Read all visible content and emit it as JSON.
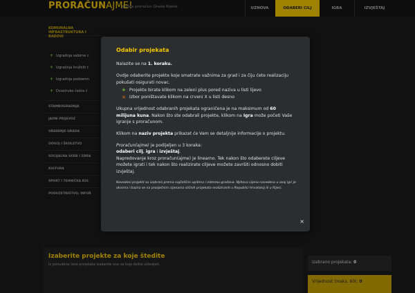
{
  "header": {
    "logo_bold": "PRORAČUN",
    "logo_light": "AJME!",
    "tagline": "dodite proračun Grada Rijeke",
    "nav": [
      "UZNOVA",
      "ODABERI CILJ",
      "IGRA",
      "IZVJEŠTAJ"
    ],
    "active_nav": "ODABERI CILJ"
  },
  "sidebar": {
    "heading": "KOMUNALNA INFRASTRUKTURA I RADOVI",
    "projects": [
      "Izgradnja sabirne c",
      "Izgradnja kružnih t",
      "Izgradnja podzemn",
      "Dvostruko češće č"
    ],
    "categories": [
      "STAMBOGRADNJA",
      "JAVNI PRIJEVOZ",
      "UREĐENJE GRADA",
      "ODGOJ I ŠKOLSTVO",
      "SOCIJALNA SKRB I ZDRA",
      "KULTURA",
      "SPORT I TEHNIČKA KUL",
      "PODUZETNIŠTVO, INFOR"
    ]
  },
  "main": {
    "title": "Izaberite projekte za koje štedite",
    "subtitle": "Iz ponuđene liste projekata izaberite one za koje želite uštedjeti."
  },
  "summary": {
    "selected_label": "Izabrano projekata:",
    "selected_value": "0",
    "value_label": "Vrijednost (maks. 60):",
    "value_value": "0"
  },
  "modal": {
    "title": "Odabir projekata",
    "step_prefix": "Nalazite se na ",
    "step_bold": "1. koraku.",
    "p1": "Ovdje odaberite projekte koje smatrate važnima za grad i za čiju ćete realizaciju pokušati osigurati novac.",
    "hint_add": "Projekte birate klikom na zeleni plus pored naziva u listi lijevo",
    "hint_remove": "Izbor poništavate klikom na crveni X u listi desno",
    "p2_a": "Ukupna vrijednost odabranih projekata ograničena je na maksimum od ",
    "p2_b": "60 milijuna kuna",
    "p2_c": ". Nakon što ste odabrali projekte, klikom na ",
    "p2_d": "Igra",
    "p2_e": " može početi Vaše igranje s proračunom.",
    "p3_a": "Klikom na ",
    "p3_b": "naziv projekta",
    "p3_c": " prikazat će Vam se detaljnije informacije o projektu.",
    "p4_a": "Proračun(ajme)",
    "p4_b": " je podijeljen u 3 koraka:",
    "p4_c": "odaberi cilj",
    "p4_d": ", ",
    "p4_e": "igra",
    "p4_f": " i ",
    "p4_g": "izvještaj",
    "p4_h": ".",
    "p5": "Napredovanje kroz proračun(ajme) je linearno. Tek nakon što odaberete ciljeve možete igrati i tek nakon što realizirate ciljeve možete završiti odnosno dobiti izvještaj.",
    "note": "Navedeni projekti su izabrani prema najčešćim upitima i interesu građana. Njihova cijena navedena u ovoj igri je okvirna i bazira se na prosječnim cijenama sličnih projekata realiziranih u Republici Hrvatskoj ili u Rijeci.",
    "close_symbol": "×",
    "icons": {
      "add": "plus-icon",
      "remove": "x-icon",
      "close": "close-icon"
    },
    "colors": {
      "title": "#f5c800",
      "plus": "#7bd43a",
      "x": "#e07020",
      "active_nav": "#f5c800"
    }
  }
}
